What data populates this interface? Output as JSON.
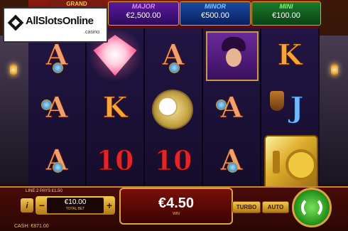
{
  "header": {
    "grand_label": "GRAND",
    "jackpots": [
      {
        "name": "MAJOR",
        "value": "€2,500.00"
      },
      {
        "name": "MINOR",
        "value": "€500.00"
      },
      {
        "name": "MINI",
        "value": "€100.00"
      }
    ]
  },
  "logo": {
    "text": "AllSlotsOnline",
    "sub": ".casino"
  },
  "reels": [
    [
      "A",
      "A",
      "A"
    ],
    [
      "diamond",
      "K",
      "10"
    ],
    [
      "A",
      "pocket-watch",
      "10"
    ],
    [
      "lady",
      "A",
      "A"
    ],
    [
      "K",
      "J",
      "vault"
    ]
  ],
  "bottom": {
    "info_line": "LINE 2 PAYS £1.50",
    "info_button": "i",
    "bet_value": "€10.00",
    "bet_label": "TOTAL BET",
    "minus": "−",
    "plus": "+",
    "win_value": "€4.50",
    "win_label": "WIN",
    "turbo_label": "TURBO",
    "auto_label": "AUTO",
    "cash_text": "CASH: €871.00"
  }
}
